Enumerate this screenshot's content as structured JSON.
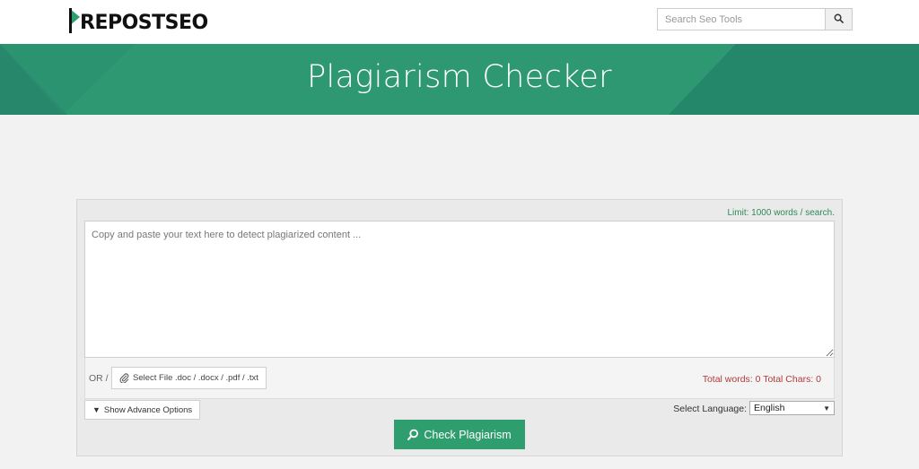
{
  "header": {
    "logo_text": "REPOSTSEO",
    "search": {
      "placeholder": "Search Seo Tools",
      "button_icon": "search-icon"
    }
  },
  "banner": {
    "title": "Plagiarism Checker"
  },
  "checker": {
    "limit_text": "Limit: 1000 words / search.",
    "textarea_placeholder": "Copy and paste your text here to detect plagiarized content ...",
    "or_label": "OR /",
    "file_button_label": "Select File .doc / .docx / .pdf / .txt",
    "counts_text": "Total words: 0 Total Chars: 0",
    "advanced_label": "Show Advance Options",
    "language_label": "Select Language:",
    "language_selected": "English",
    "check_button_label": "Check Plagiarism"
  },
  "colors": {
    "brand_green": "#2e9872",
    "button_green": "#2e9e6e",
    "count_red": "#b03a3a",
    "limit_green": "#2e8b57"
  }
}
